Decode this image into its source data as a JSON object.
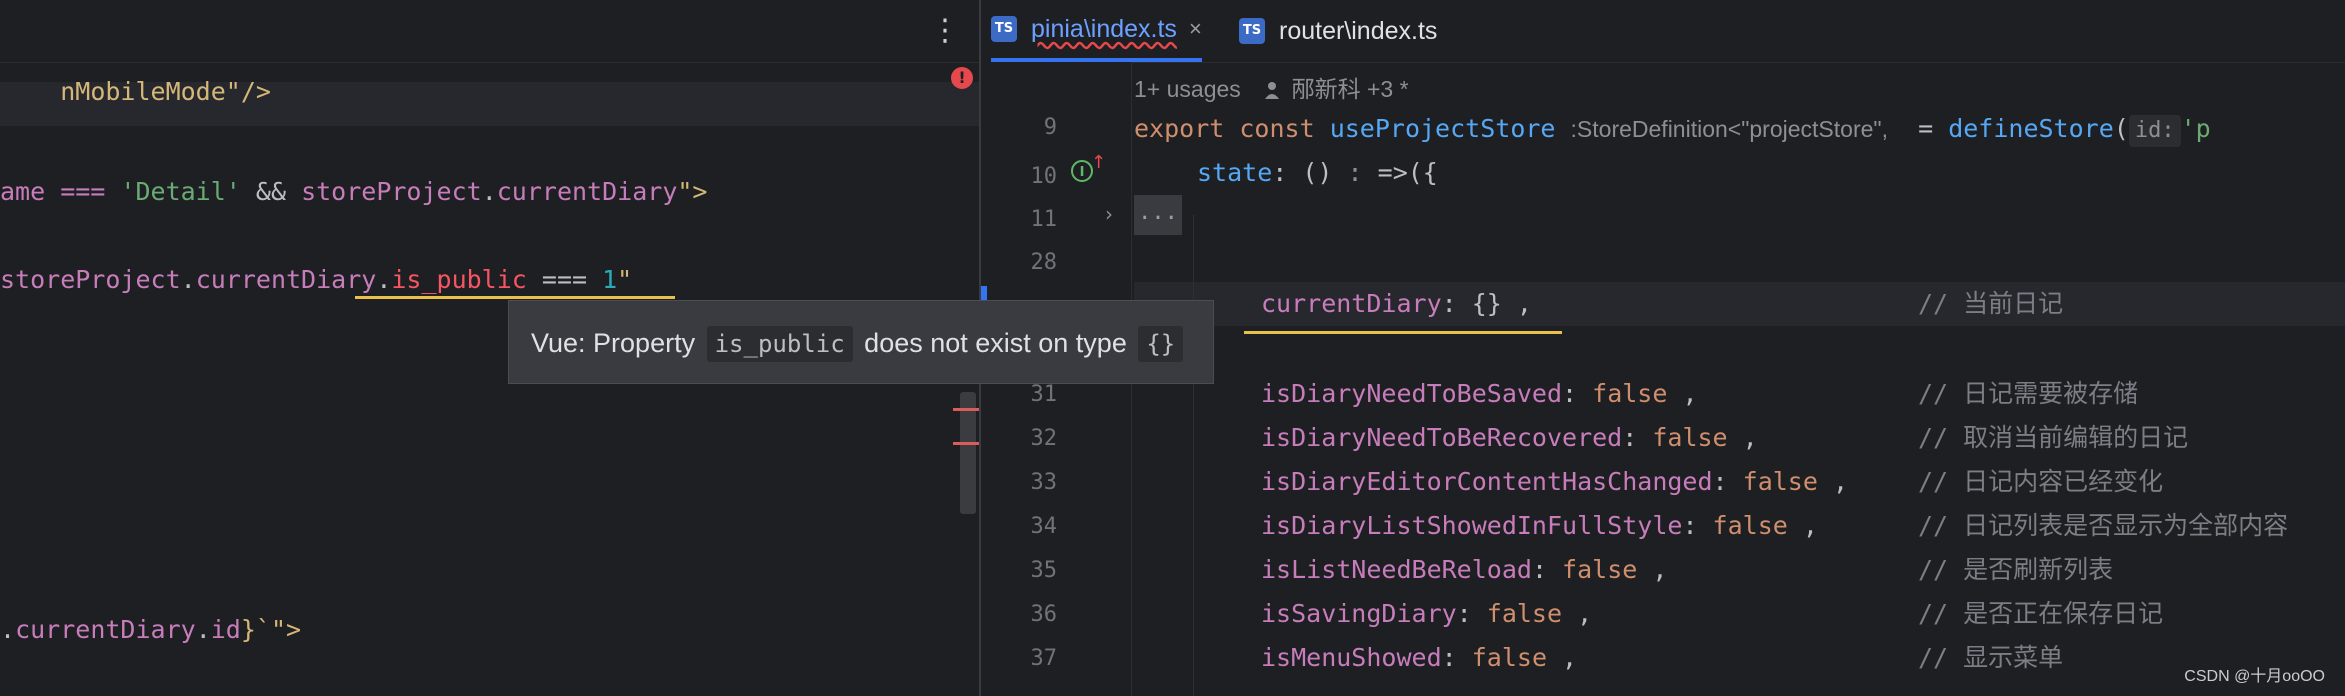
{
  "left": {
    "line1": {
      "tail": "nMobileMode\"/>"
    },
    "line2": {
      "a": "ame === ",
      "b": "'Detail'",
      "c": " && ",
      "d": "storeProject",
      "e": ".",
      "f": "currentDiary",
      "g": "\">"
    },
    "line3": {
      "a": "storeProject",
      "b": ".",
      "c": "currentDiary",
      "d": ".",
      "e": "is_public",
      "f": " === ",
      "g": "1",
      "h": "\""
    },
    "line4": {
      "a": ".",
      "b": "currentDiary",
      "c": ".",
      "d": "id",
      "e": "}`\">"
    }
  },
  "tooltip": {
    "prefix": "Vue: Property",
    "code": "is_public",
    "middle": "does not exist on type",
    "type": "{}"
  },
  "tabs": [
    {
      "icon": "TS",
      "label": "pinia\\index.ts",
      "close": "×"
    },
    {
      "icon": "TS",
      "label": "router\\index.ts"
    }
  ],
  "usages": {
    "count": "1+ usages",
    "author": "邴新科 +3 *"
  },
  "gutter": {
    "n9": "9",
    "n10": "10",
    "n11": "11",
    "n28": "28",
    "n31": "31",
    "n32": "32",
    "n33": "33",
    "n34": "34",
    "n35": "35",
    "n36": "36",
    "n37": "37",
    "badge": "I"
  },
  "code": {
    "l9": {
      "kw1": "export",
      "kw2": "const",
      "name": "useProjectStore",
      "type_hint": ":StoreDefinition<\"projectStore\",",
      "eq": "= ",
      "fn": "defineStore",
      "paren": "(",
      "id_hint": "id:",
      "str": "'p"
    },
    "l10": {
      "prop": "state",
      "rest": ": () ",
      "hint": ":",
      "arrow": " =>({"
    },
    "fold": "...",
    "rows": [
      {
        "prop": "currentDiary",
        "sep": ": ",
        "val": "{}",
        "tail": " ,",
        "comment": "// 当前日记"
      },
      {
        "prop": "isDiaryNeedToBeSaved",
        "sep": ": ",
        "val": "false",
        "tail": " ,",
        "comment": "// 日记需要被存储"
      },
      {
        "prop": "isDiaryNeedToBeRecovered",
        "sep": ": ",
        "val": "false",
        "tail": " ,",
        "comment": "// 取消当前编辑的日记"
      },
      {
        "prop": "isDiaryEditorContentHasChanged",
        "sep": ": ",
        "val": "false",
        "tail": " ,",
        "comment": "// 日记内容已经变化"
      },
      {
        "prop": "isDiaryListShowedInFullStyle",
        "sep": ": ",
        "val": "false",
        "tail": " ,",
        "comment": "// 日记列表是否显示为全部内容"
      },
      {
        "prop": "isListNeedBeReload",
        "sep": ": ",
        "val": "false",
        "tail": " ,",
        "comment": "// 是否刷新列表"
      },
      {
        "prop": "isSavingDiary",
        "sep": ": ",
        "val": "false",
        "tail": " ,",
        "comment": "// 是否正在保存日记"
      },
      {
        "prop": "isMenuShowed",
        "sep": ": ",
        "val": "false",
        "tail": " ,",
        "comment": "// 显示菜单"
      }
    ]
  },
  "watermark": "CSDN @十月ooOO",
  "colors": {
    "accent": "#3574f0",
    "error": "#e5494d",
    "warning": "#e8c04a",
    "background": "#1e1f22"
  },
  "icons": [
    "more-vertical-icon",
    "error-icon",
    "ts-file-icon",
    "close-icon",
    "person-icon",
    "implemented-icon",
    "chevron-right-icon"
  ]
}
